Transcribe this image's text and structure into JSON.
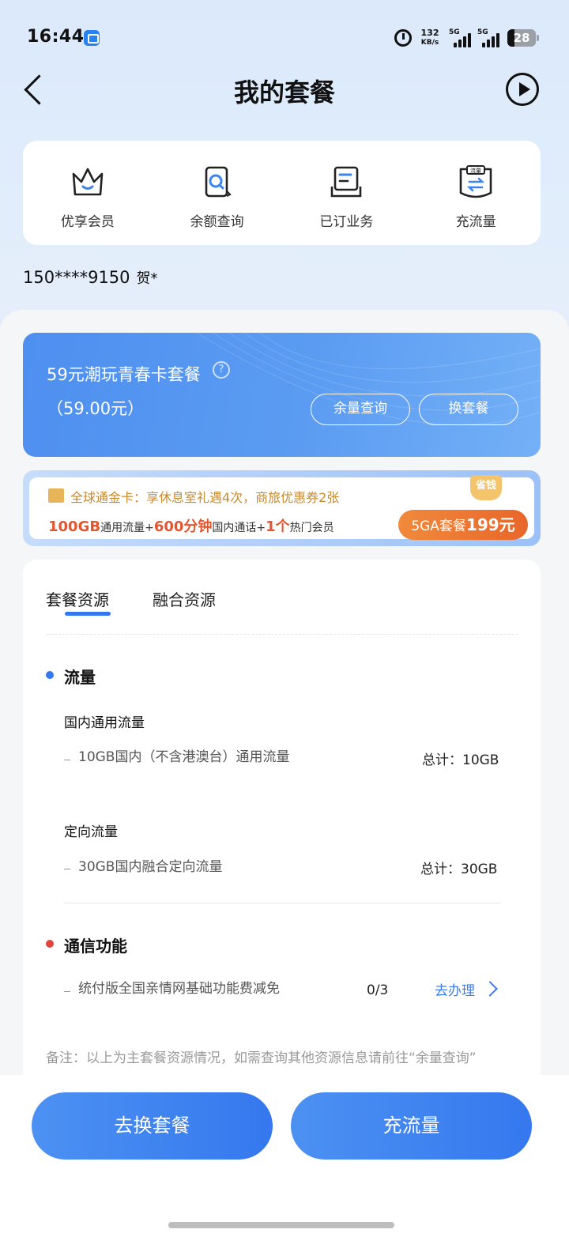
{
  "status": {
    "time": "16:44",
    "speed_value": "132",
    "speed_unit": "KB/s",
    "net1": "5G",
    "net2": "5G",
    "battery": "28"
  },
  "nav": {
    "title": "我的套餐"
  },
  "quick": [
    {
      "label": "优享会员",
      "icon": "crown-icon"
    },
    {
      "label": "余额查询",
      "icon": "search-doc-icon"
    },
    {
      "label": "已订业务",
      "icon": "orders-icon"
    },
    {
      "label": "充流量",
      "icon": "traffic-icon"
    }
  ],
  "quick_icon_text": "流量",
  "account": {
    "phone": "150****9150",
    "name": "贺*"
  },
  "package": {
    "name": "59元潮玩青春卡套餐",
    "help": "?",
    "price": "（59.00元）",
    "btn_query": "余量查询",
    "btn_change": "换套餐"
  },
  "promo": {
    "line1": "全球通金卡：享休息室礼遇4次，商旅优惠券2张",
    "l2_a": "100GB",
    "l2_b": "通用流量+",
    "l2_c": "600分钟",
    "l2_d": "国内通话+",
    "l2_e": "1个",
    "l2_f": "热门会员",
    "tag": "省钱",
    "btn_a": "5GA套餐",
    "btn_b": "199元"
  },
  "tabs": [
    "套餐资源",
    "融合资源"
  ],
  "traffic": {
    "title": "流量",
    "general_title": "国内通用流量",
    "general_item": "10GB国内（不含港澳台）通用流量",
    "general_total": "总计：10GB",
    "directed_title": "定向流量",
    "directed_item": "30GB国内融合定向流量",
    "directed_total": "总计：30GB"
  },
  "comm": {
    "title": "通信功能",
    "item": "统付版全国亲情网基础功能费减免",
    "count": "0/3",
    "action": "去办理"
  },
  "remark": "备注：以上为主套餐资源情况，如需查询其他资源信息请前往“余量查询”",
  "bottom": {
    "change": "去换套餐",
    "recharge": "充流量"
  },
  "colors": {
    "accent": "#3478f0",
    "traffic_dot": "#3478f0",
    "comm_dot": "#e0463c",
    "promo_orange": "#e9662a"
  }
}
